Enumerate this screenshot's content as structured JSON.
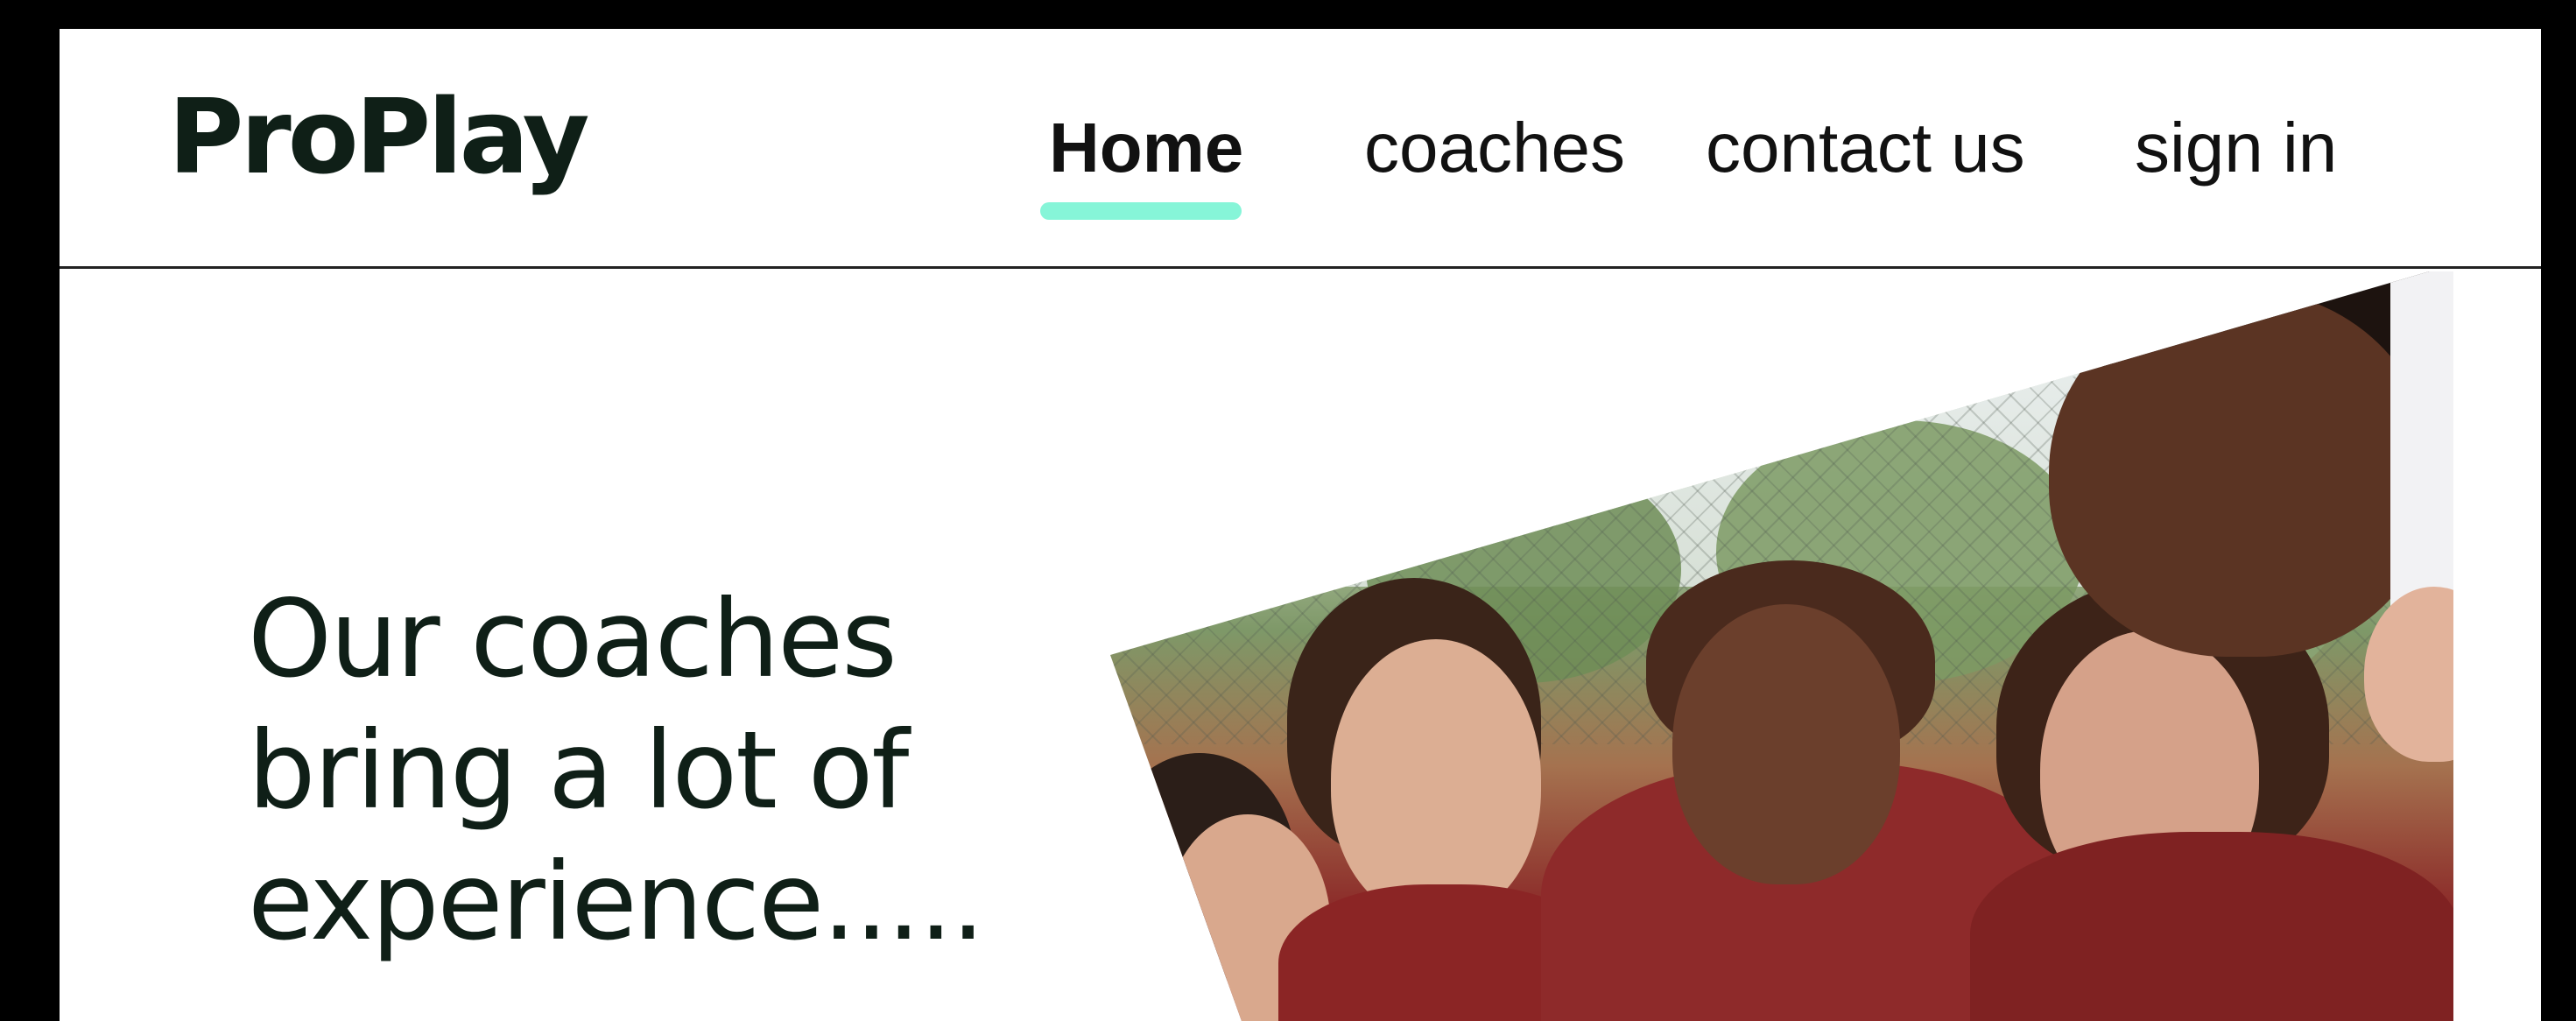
{
  "brand": {
    "logo_text": "ProPlay"
  },
  "nav": {
    "items": [
      {
        "label": "Home",
        "active": true
      },
      {
        "label": "coaches",
        "active": false
      },
      {
        "label": "contact us",
        "active": false
      },
      {
        "label": "sign in",
        "active": false
      }
    ]
  },
  "hero": {
    "headline": "Our coaches bring a lot of experience.....",
    "image_alt": "team huddle"
  },
  "colors": {
    "accent_underline": "#86f5d8",
    "text_dark": "#0f1f17",
    "background": "#ffffff",
    "frame": "#000000"
  }
}
